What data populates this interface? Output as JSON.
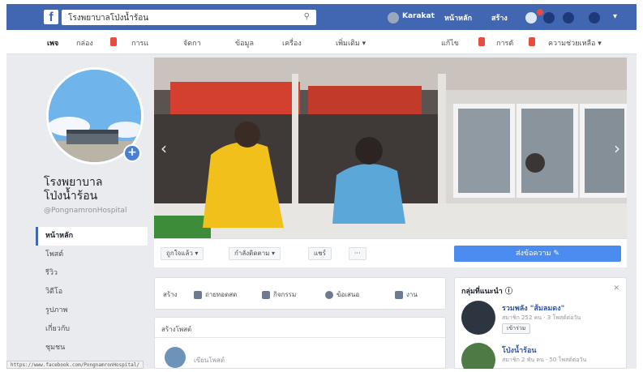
{
  "topbar": {
    "search_value": "โรงพยาบาลโป่งน้ำร้อน",
    "user_name": "Karakat",
    "nav_home": "หน้าหลัก",
    "nav_create": "สร้าง",
    "notification_count": "1",
    "brand_color": "#4267b2"
  },
  "tabs": {
    "items": [
      {
        "label": "เพจ",
        "active": true
      },
      {
        "label": "กล่อง"
      },
      {
        "label": "การแ"
      },
      {
        "label": "จัดกา"
      },
      {
        "label": "ข้อมูล"
      },
      {
        "label": "เครื่อง"
      },
      {
        "label": "เพิ่มเติม ▾"
      }
    ],
    "right": [
      {
        "label": "แก้ไข"
      },
      {
        "label": "การตั"
      },
      {
        "label": "ความช่วยเหลือ ▾"
      }
    ]
  },
  "profile": {
    "name": "โรงพยาบาล โป่งน้ำร้อน",
    "handle": "@PongnamronHospital"
  },
  "side_nav": [
    {
      "label": "หน้าหลัก",
      "active": true
    },
    {
      "label": "โพสต์"
    },
    {
      "label": "รีวิว"
    },
    {
      "label": "วิดีโอ"
    },
    {
      "label": "รูปภาพ"
    },
    {
      "label": "เกี่ยวกับ"
    },
    {
      "label": "ชุมชน"
    }
  ],
  "actions": {
    "like": "ถูกใจแล้ว ▾",
    "follow": "กำลังติดตาม ▾",
    "share": "แชร์",
    "more": "···",
    "contact": "ส่งข้อความ ✎"
  },
  "composer": {
    "items": [
      "สร้าง",
      "ถ่ายทอดสด",
      "กิจกรรม",
      "ข้อเสนอ",
      "งาน"
    ],
    "post_title": "สร้างโพสต์",
    "post_placeholder": "เขียนโพสต์"
  },
  "groups": {
    "title": "กลุ่มที่แนะนำ ⓘ",
    "close": "✕",
    "items": [
      {
        "name": "รวมพลัง \"ส้มลมดง\"",
        "meta": "สมาชิก 252 คน · 3 โพสต์ต่อวัน",
        "join": "เข้าร่วม"
      },
      {
        "name": "โป่งน้ำร้อน",
        "meta": "สมาชิก 2 พัน คน · 50 โพสต์ต่อวัน"
      }
    ]
  },
  "status_url": "https://www.facebook.com/PongnamronHospital/"
}
